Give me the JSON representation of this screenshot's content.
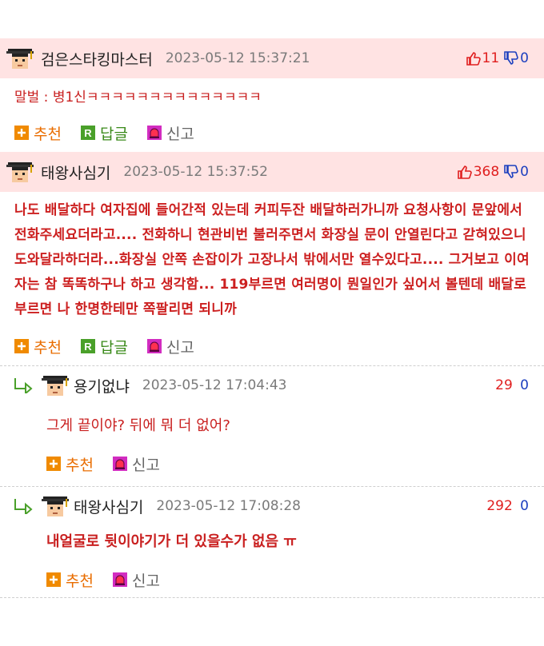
{
  "comments": [
    {
      "nick": "검은스타킹마스터",
      "date": "2023-05-12 15:37:21",
      "up": "11",
      "down": "0",
      "body": "말벌 : 병1신ㅋㅋㅋㅋㅋㅋㅋㅋㅋㅋㅋㅋㅋㅋ",
      "actions": {
        "recommend": "추천",
        "reply": "답글",
        "report": "신고"
      }
    },
    {
      "nick": "태왕사심기",
      "date": "2023-05-12 15:37:52",
      "up": "368",
      "down": "0",
      "body": "나도 배달하다 여자집에 들어간적 있는데 커피두잔 배달하러가니까 요청사항이 문앞에서 전화주세요더라고.... 전화하니 현관비번 불러주면서 화장실 문이 안열린다고 갇혀있으니 도와달라하더라...화장실 안쪽 손잡이가 고장나서 밖에서만 열수있다고.... 그거보고 이여자는 참 똑똑하구나 하고 생각함... 119부르면 여러명이 뭔일인가 싶어서 볼텐데 배달로 부르면 나 한명한테만 쪽팔리면 되니까",
      "actions": {
        "recommend": "추천",
        "reply": "답글",
        "report": "신고"
      }
    }
  ],
  "replies": [
    {
      "nick": "용기없냐",
      "date": "2023-05-12 17:04:43",
      "up": "29",
      "down": "0",
      "body": "그게 끝이야? 뒤에 뭐 더 없어?",
      "actions": {
        "recommend": "추천",
        "report": "신고"
      }
    },
    {
      "nick": "태왕사심기",
      "date": "2023-05-12 17:08:28",
      "up": "292",
      "down": "0",
      "body": "내얼굴로 뒷이야기가 더 있을수가 없음 ㅠ",
      "actions": {
        "recommend": "추천",
        "report": "신고"
      }
    }
  ],
  "icons": {
    "avatar": "graduate-avatar-icon",
    "thumbs_up": "thumbs-up-icon",
    "thumbs_down": "thumbs-down-icon",
    "recommend": "plus-icon",
    "reply": "reply-r-icon",
    "report": "siren-icon",
    "reply_arrow": "reply-arrow-icon"
  },
  "colors": {
    "best_bg": "#ffe3e3",
    "up": "#e01e1e",
    "down": "#1c3fbf",
    "body": "#c92020"
  }
}
